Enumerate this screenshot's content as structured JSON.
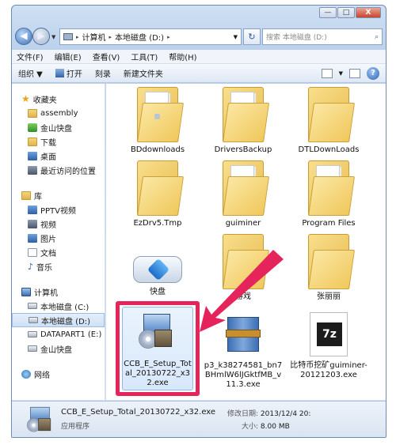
{
  "window": {
    "minimize": "—",
    "maximize": "□",
    "close": "X"
  },
  "nav": {
    "back": "◀",
    "forward": "▶",
    "address": [
      "计算机",
      "本地磁盘 (D:)"
    ],
    "refresh": "↻",
    "search_placeholder": "搜索 本地磁盘 (D:)"
  },
  "menu": [
    "文件(F)",
    "编辑(E)",
    "查看(V)",
    "工具(T)",
    "帮助(H)"
  ],
  "toolbar": {
    "organize": "组织 ▼",
    "open": "打开",
    "burn": "刻录",
    "new_folder": "新建文件夹",
    "help": "?"
  },
  "sidebar": {
    "favorites": "收藏夹",
    "fav_items": [
      "assembly",
      "金山快盘",
      "下载",
      "桌面",
      "最近访问的位置"
    ],
    "library": "库",
    "lib_items": [
      "PPTV视频",
      "视频",
      "图片",
      "文档",
      "音乐"
    ],
    "computer": "计算机",
    "comp_items": [
      "本地磁盘 (C:)",
      "本地磁盘 (D:)",
      "DATAPART1 (E:)",
      "金山快盘"
    ],
    "network": "网络"
  },
  "files": [
    {
      "name": "BDdownloads"
    },
    {
      "name": "DriversBackup"
    },
    {
      "name": "DTLDownLoads"
    },
    {
      "name": "EzDrv5.Tmp"
    },
    {
      "name": "guiminer"
    },
    {
      "name": "Program Files"
    },
    {
      "name": "快盘"
    },
    {
      "name": "游戏"
    },
    {
      "name": "张丽丽"
    },
    {
      "name": "CCB_E_Setup_Total_20130722_x32.exe"
    },
    {
      "name": "p3_k38274581_bn7BHmlW6lJGktfMB_v11.3.exe"
    },
    {
      "name": "比特币挖矿guiminer-20121203.exe"
    }
  ],
  "details": {
    "name": "CCB_E_Setup_Total_20130722_x32.exe",
    "type": "应用程序",
    "modified_label": "修改日期:",
    "modified": "2013/12/4 20:",
    "size_label": "大小:",
    "size": "8.00 MB"
  },
  "colors": {
    "highlight": "#e5245b",
    "folder": "#f0c85c"
  }
}
